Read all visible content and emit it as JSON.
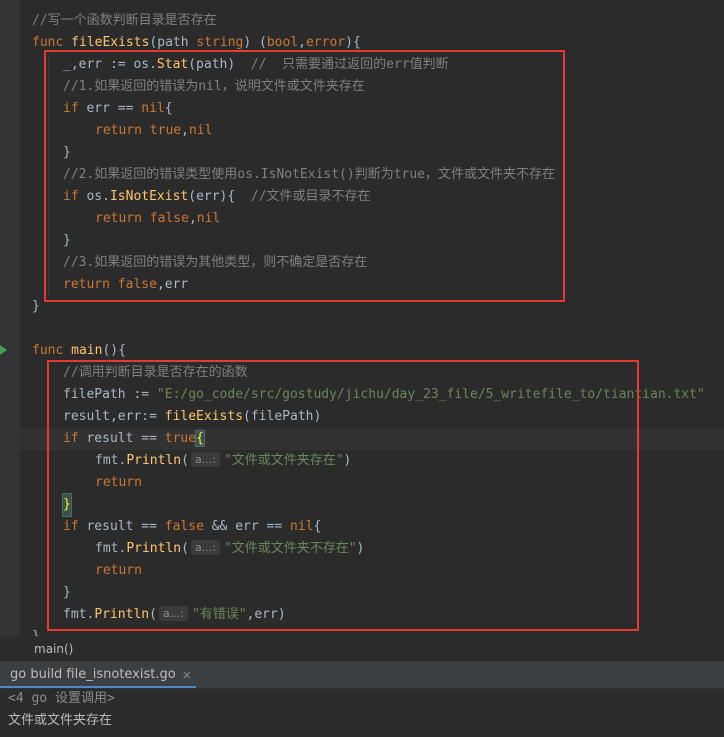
{
  "editor": {
    "lines": {
      "l0": "//写一个函数判断目录是否存在",
      "l1_func": "func ",
      "l1_name": "fileExists",
      "l1_rest": "(path ",
      "l1_string": "string",
      "l1_ret": ") (",
      "l1_bool": "bool",
      "l1_comma": ",",
      "l1_error": "error",
      "l1_end": "){",
      "l2_code": "_,err := os.",
      "l2_fn": "Stat",
      "l2_args": "(path)  ",
      "l2_cm": "//  只需要通过返回的err值判断",
      "l3": "//1.如果返回的错误为nil，说明文件或文件夹存在",
      "l4_if": "if ",
      "l4_rest": "err == ",
      "l4_nil": "nil",
      "l4_brace": "{",
      "l5_ret": "return ",
      "l5_true": "true",
      "l5_rest": ",",
      "l5_nil": "nil",
      "l6": "}",
      "l7": "//2.如果返回的错误类型使用os.IsNotExist()判断为true，文件或文件夹不存在",
      "l8_if": "if ",
      "l8_os": "os.",
      "l8_fn": "IsNotExist",
      "l8_rest": "(err){  ",
      "l8_cm": "//文件或目录不存在",
      "l9_ret": "return ",
      "l9_false": "false",
      "l9_rest": ",",
      "l9_nil": "nil",
      "l10": "}",
      "l11": "//3.如果返回的错误为其他类型，则不确定是否存在",
      "l12_ret": "return ",
      "l12_false": "false",
      "l12_rest": ",err",
      "l13": "}",
      "l15_func": "func ",
      "l15_name": "main",
      "l15_rest": "(){",
      "l16": "//调用判断目录是否存在的函数",
      "l17_code": "filePath := ",
      "l17_str": "\"E:/go_code/src/gostudy/jichu/day_23_file/5_writefile_to/tiantian.txt\"",
      "l18_code": "result,err:= ",
      "l18_fn": "fileExists",
      "l18_rest": "(filePath)",
      "l19_if": "if ",
      "l19_rest": "result == ",
      "l19_true": "true",
      "l19_brace": "{",
      "l20_code": "fmt.",
      "l20_fn": "Println",
      "l20_open": "(",
      "l20_hint": "a...:",
      "l20_str": "\"文件或文件夹存在\"",
      "l20_close": ")",
      "l21": "return",
      "l22": "}",
      "l23_if": "if ",
      "l23_rest": "result == ",
      "l23_false": "false",
      "l23_and": " && err == ",
      "l23_nil": "nil",
      "l23_brace": "{",
      "l24_code": "fmt.",
      "l24_fn": "Println",
      "l24_open": "(",
      "l24_hint": "a...:",
      "l24_str": "\"文件或文件夹不存在\"",
      "l24_close": ")",
      "l25": "return",
      "l26": "}",
      "l27_code": "fmt.",
      "l27_fn": "Println",
      "l27_open": "(",
      "l27_hint": "a...:",
      "l27_str": "\"有错误\"",
      "l27_close": ",err)",
      "l28": "}"
    }
  },
  "breadcrumb": {
    "label": "main()"
  },
  "run_panel": {
    "tab_label": "go build file_isnotexist.go",
    "close_glyph": "×"
  },
  "console": {
    "line1": "<4 go 设置调用>",
    "line2": "文件或文件夹存在"
  },
  "colors": {
    "background": "#2b2b2b",
    "keyword": "#cc7832",
    "function": "#ffc66d",
    "string": "#6a8759",
    "comment": "#808080",
    "annotation_box": "#e53935"
  }
}
